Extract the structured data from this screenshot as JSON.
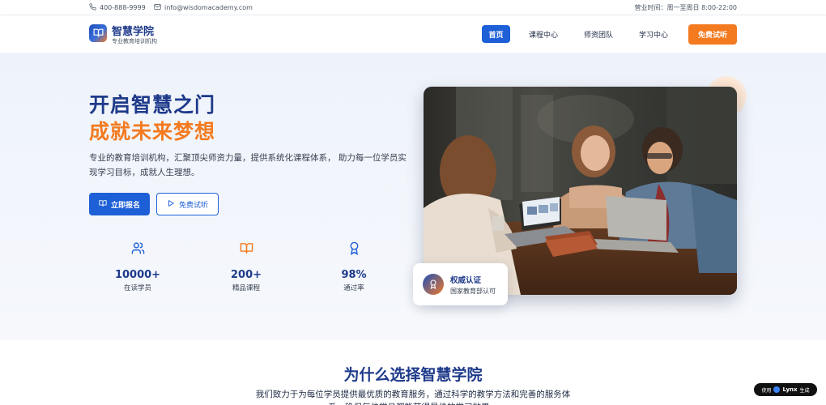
{
  "topbar": {
    "phone": "400-888-9999",
    "email": "info@wisdomacademy.com",
    "hours": "营业时间：周一至周日 8:00-22:00"
  },
  "brand": {
    "name": "智慧学院",
    "tagline": "专业教育培训机构"
  },
  "nav": {
    "home": "首页",
    "courses": "课程中心",
    "teachers": "师资团队",
    "learning": "学习中心",
    "trial": "免费试听"
  },
  "hero": {
    "title_line1": "开启智慧之门",
    "title_line2": "成就未来梦想",
    "description": "专业的教育培训机构，汇聚顶尖师资力量，提供系统化课程体系， 助力每一位学员实现学习目标，成就人生理想。",
    "enroll_button": "立即报名",
    "trial_button": "免费试听"
  },
  "stats": [
    {
      "value": "10000+",
      "label": "在读学员",
      "icon": "users-icon"
    },
    {
      "value": "200+",
      "label": "精品课程",
      "icon": "book-open-icon"
    },
    {
      "value": "98%",
      "label": "通过率",
      "icon": "award-icon"
    }
  ],
  "certification": {
    "title": "权威认证",
    "subtitle": "国家教育部认可",
    "icon": "award-icon"
  },
  "why": {
    "title": "为什么选择智慧学院",
    "description": "我们致力于为每位学员提供最优质的教育服务，通过科学的教学方法和完善的服务体系，确保每位学员都能获得最佳的学习效果。"
  },
  "footer_badge": {
    "prefix": "使用",
    "brand": "Lynx",
    "suffix": "生成"
  },
  "colors": {
    "primary": "#1d5fd6",
    "navy": "#1e3a8a",
    "accent": "#f47a1f"
  }
}
